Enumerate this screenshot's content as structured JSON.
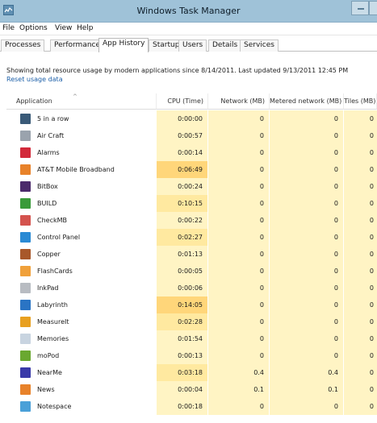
{
  "window": {
    "title": "Windows Task Manager",
    "colors": {
      "titlebar": "#9fc2d8",
      "cpu_heat_light": "#fff4c4",
      "cpu_heat_medium": "#ffe9a0",
      "cpu_heat_strong": "#ffd67a",
      "link": "#1c5fa8"
    }
  },
  "menu": [
    "File",
    "Options",
    "View",
    "Help"
  ],
  "tabs": [
    {
      "label": "Processes",
      "active": false
    },
    {
      "label": "Performance",
      "active": false
    },
    {
      "label": "App History",
      "active": true
    },
    {
      "label": "Startup",
      "active": false
    },
    {
      "label": "Users",
      "active": false
    },
    {
      "label": "Details",
      "active": false
    },
    {
      "label": "Services",
      "active": false
    }
  ],
  "info_text": "Showing total resource usage by modern applications since 8/14/2011. Last updated 9/13/2011 12:45 PM",
  "reset_link": "Reset usage data",
  "columns": {
    "application": "Application",
    "cpu": "CPU (Time)",
    "network": "Network (MB)",
    "metered": "Metered network (MB)",
    "tiles": "Tiles (MB)"
  },
  "rows": [
    {
      "name": "5 in a row",
      "icon": "five-in-a-row-icon",
      "icon_color": "#3a5a78",
      "cpu": "0:00:00",
      "network": "0",
      "metered": "0",
      "tiles": "0",
      "heat": "light"
    },
    {
      "name": "Air Craft",
      "icon": "air-craft-icon",
      "icon_color": "#9aa3ad",
      "cpu": "0:00:57",
      "network": "0",
      "metered": "0",
      "tiles": "0",
      "heat": "light"
    },
    {
      "name": "Alarms",
      "icon": "alarms-icon",
      "icon_color": "#d2293a",
      "cpu": "0:00:14",
      "network": "0",
      "metered": "0",
      "tiles": "0",
      "heat": "light"
    },
    {
      "name": "AT&T Mobile Broadband",
      "icon": "att-broadband-icon",
      "icon_color": "#e8822a",
      "cpu": "0:06:49",
      "network": "0",
      "metered": "0",
      "tiles": "0",
      "heat": "strong"
    },
    {
      "name": "BitBox",
      "icon": "bitbox-icon",
      "icon_color": "#4b2a6b",
      "cpu": "0:00:24",
      "network": "0",
      "metered": "0",
      "tiles": "0",
      "heat": "light"
    },
    {
      "name": "BUILD",
      "icon": "build-icon",
      "icon_color": "#3a9a3a",
      "cpu": "0:10:15",
      "network": "0",
      "metered": "0",
      "tiles": "0",
      "heat": "medium"
    },
    {
      "name": "CheckMB",
      "icon": "checkmb-icon",
      "icon_color": "#d4534e",
      "cpu": "0:00:22",
      "network": "0",
      "metered": "0",
      "tiles": "0",
      "heat": "light"
    },
    {
      "name": "Control Panel",
      "icon": "control-panel-icon",
      "icon_color": "#2a8ad4",
      "cpu": "0:02:27",
      "network": "0",
      "metered": "0",
      "tiles": "0",
      "heat": "medium"
    },
    {
      "name": "Copper",
      "icon": "copper-icon",
      "icon_color": "#a8582a",
      "cpu": "0:01:13",
      "network": "0",
      "metered": "0",
      "tiles": "0",
      "heat": "light"
    },
    {
      "name": "FlashCards",
      "icon": "flashcards-icon",
      "icon_color": "#f0a03a",
      "cpu": "0:00:05",
      "network": "0",
      "metered": "0",
      "tiles": "0",
      "heat": "light"
    },
    {
      "name": "InkPad",
      "icon": "inkpad-icon",
      "icon_color": "#b8bcc2",
      "cpu": "0:00:06",
      "network": "0",
      "metered": "0",
      "tiles": "0",
      "heat": "light"
    },
    {
      "name": "Labyrinth",
      "icon": "labyrinth-icon",
      "icon_color": "#2a74c4",
      "cpu": "0:14:05",
      "network": "0",
      "metered": "0",
      "tiles": "0",
      "heat": "strong"
    },
    {
      "name": "MeasureIt",
      "icon": "measureit-icon",
      "icon_color": "#e8a020",
      "cpu": "0:02:28",
      "network": "0",
      "metered": "0",
      "tiles": "0",
      "heat": "medium"
    },
    {
      "name": "Memories",
      "icon": "memories-icon",
      "icon_color": "#c8d4e0",
      "cpu": "0:01:54",
      "network": "0",
      "metered": "0",
      "tiles": "0",
      "heat": "light"
    },
    {
      "name": "moPod",
      "icon": "mopod-icon",
      "icon_color": "#6aa830",
      "cpu": "0:00:13",
      "network": "0",
      "metered": "0",
      "tiles": "0",
      "heat": "light"
    },
    {
      "name": "NearMe",
      "icon": "nearme-icon",
      "icon_color": "#3a3aa8",
      "cpu": "0:03:18",
      "network": "0.4",
      "metered": "0.4",
      "tiles": "0",
      "heat": "medium"
    },
    {
      "name": "News",
      "icon": "news-icon",
      "icon_color": "#e8822a",
      "cpu": "0:00:04",
      "network": "0.1",
      "metered": "0.1",
      "tiles": "0",
      "heat": "light"
    },
    {
      "name": "Notespace",
      "icon": "notespace-icon",
      "icon_color": "#4aa0d8",
      "cpu": "0:00:18",
      "network": "0",
      "metered": "0",
      "tiles": "0",
      "heat": "light"
    }
  ]
}
